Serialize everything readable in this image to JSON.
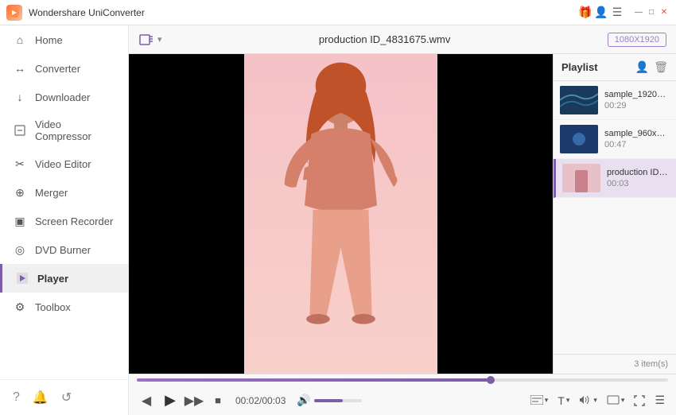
{
  "titlebar": {
    "app_name": "Wondershare UniConverter",
    "logo_text": "W"
  },
  "sidebar": {
    "items": [
      {
        "id": "home",
        "label": "Home",
        "icon": "⌂"
      },
      {
        "id": "converter",
        "label": "Converter",
        "icon": "↔"
      },
      {
        "id": "downloader",
        "label": "Downloader",
        "icon": "↓"
      },
      {
        "id": "video-compressor",
        "label": "Video Compressor",
        "icon": "⊟"
      },
      {
        "id": "video-editor",
        "label": "Video Editor",
        "icon": "✂"
      },
      {
        "id": "merger",
        "label": "Merger",
        "icon": "⊕"
      },
      {
        "id": "screen-recorder",
        "label": "Screen Recorder",
        "icon": "▣"
      },
      {
        "id": "dvd-burner",
        "label": "DVD Burner",
        "icon": "◎"
      },
      {
        "id": "player",
        "label": "Player",
        "icon": "▶",
        "active": true
      },
      {
        "id": "toolbox",
        "label": "Toolbox",
        "icon": "⚙"
      }
    ],
    "bottom_icons": [
      "?",
      "🔔",
      "↺"
    ]
  },
  "player": {
    "add_btn_label": "+",
    "filename": "production ID_4831675.wmv",
    "resolution": "1080X1920",
    "time_current": "00:02/00:03",
    "progress_percent": 66.6,
    "volume_percent": 60
  },
  "playlist": {
    "title": "Playlist",
    "items_count": "3 item(s)",
    "items": [
      {
        "name": "sample_1920x10...",
        "duration": "00:29",
        "type": "nature"
      },
      {
        "name": "sample_960x400...",
        "duration": "00:47",
        "type": "blue"
      },
      {
        "name": "production ID_4...",
        "duration": "00:03",
        "type": "pink",
        "active": true
      }
    ]
  },
  "controls": {
    "prev_label": "⏮",
    "play_label": "▶",
    "next_label": "⏭",
    "stop_label": "■",
    "volume_icon": "🔊",
    "subtitle_label": "CC",
    "text_label": "T",
    "audio_label": "♪",
    "screen_label": "⊡",
    "fullscreen_label": "⛶",
    "menu_label": "☰"
  }
}
